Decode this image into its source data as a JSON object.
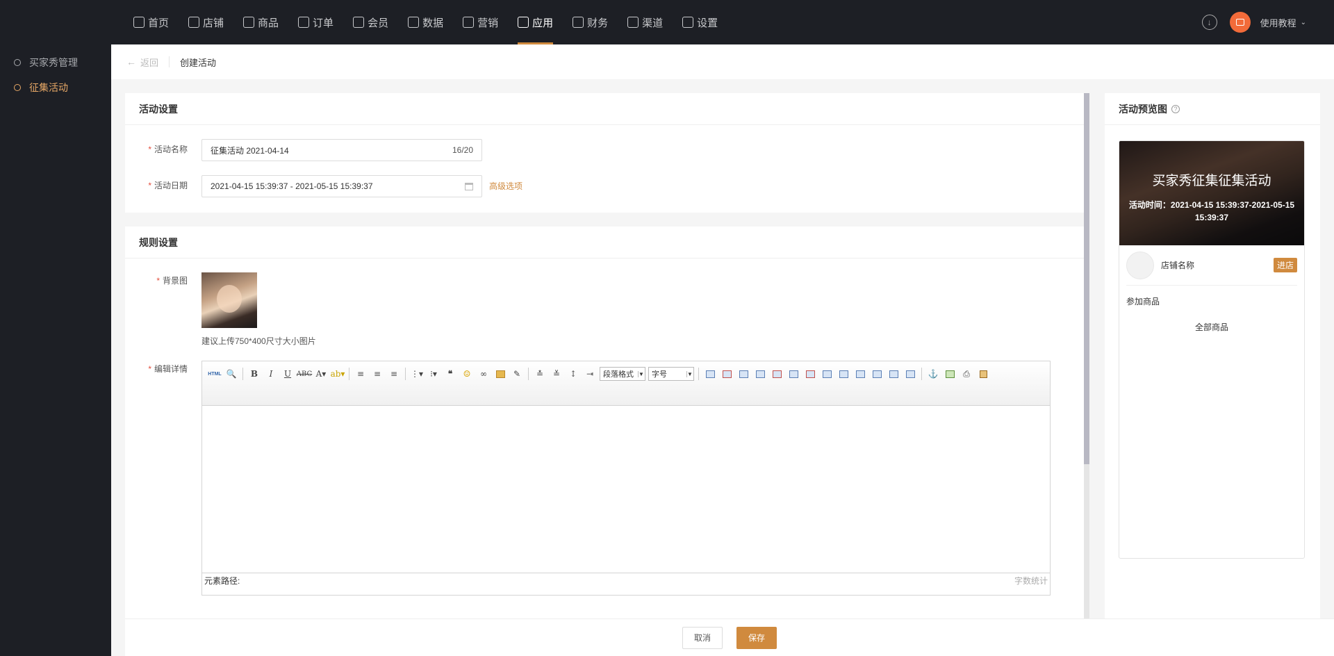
{
  "nav": {
    "items": [
      {
        "label": "首页",
        "icon": "home-icon"
      },
      {
        "label": "店铺",
        "icon": "store-icon"
      },
      {
        "label": "商品",
        "icon": "goods-icon"
      },
      {
        "label": "订单",
        "icon": "order-icon"
      },
      {
        "label": "会员",
        "icon": "user-icon"
      },
      {
        "label": "数据",
        "icon": "chart-icon"
      },
      {
        "label": "营销",
        "icon": "tag-icon"
      },
      {
        "label": "应用",
        "icon": "app-icon"
      },
      {
        "label": "财务",
        "icon": "finance-icon"
      },
      {
        "label": "渠道",
        "icon": "channel-icon"
      },
      {
        "label": "设置",
        "icon": "gear-icon"
      }
    ],
    "active_index": 7,
    "tutorial_label": "使用教程"
  },
  "sidebar": {
    "items": [
      {
        "label": "买家秀管理"
      },
      {
        "label": "征集活动"
      }
    ],
    "active_index": 1
  },
  "breadcrumb": {
    "back_label": "返回",
    "title": "创建活动"
  },
  "activity_settings": {
    "title": "活动设置",
    "name_label": "活动名称",
    "name_value": "征集活动  2021-04-14",
    "name_count": "16/20",
    "date_label": "活动日期",
    "date_value": "2021-04-15 15:39:37 - 2021-05-15 15:39:37",
    "advanced_label": "高级选项"
  },
  "rule_settings": {
    "title": "规则设置",
    "bg_label": "背景图",
    "bg_hint": "建议上传750*400尺寸大小图片",
    "detail_label": "编辑详情"
  },
  "editor": {
    "paragraph_format": "段落格式",
    "font_size": "字号",
    "element_path": "元素路径:",
    "word_count": "字数统计"
  },
  "preview": {
    "title": "活动预览图",
    "banner_title": "买家秀征集征集活动",
    "banner_time": "活动时间：2021-04-15 15:39:37-2021-05-15 15:39:37",
    "shop_name": "店铺名称",
    "enter_label": "进店",
    "join_title": "参加商品",
    "all_goods": "全部商品"
  },
  "footer": {
    "cancel_label": "取消",
    "save_label": "保存"
  },
  "colors": {
    "accent": "#d08a3e",
    "topbar_bg": "#1d1f25",
    "required": "#e34d3c"
  }
}
